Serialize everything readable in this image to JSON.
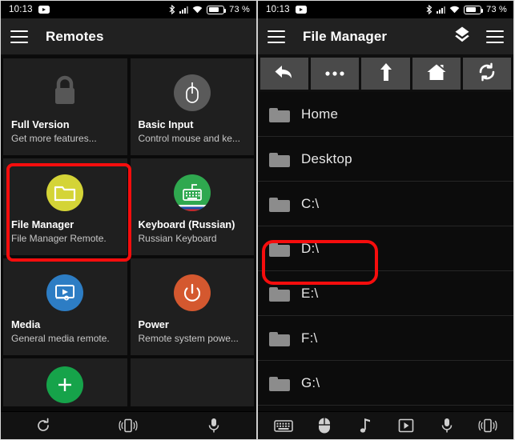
{
  "statusbar": {
    "time": "10:13",
    "notification_icon": "youtube-icon",
    "bluetooth_icon": "bluetooth-icon",
    "signal_icon": "cellular-signal-icon",
    "wifi_icon": "wifi-icon",
    "battery_icon": "battery-icon",
    "battery_percent": "73 %"
  },
  "left_phone": {
    "appbar": {
      "menu_icon": "hamburger-menu-icon",
      "title": "Remotes"
    },
    "tiles": [
      {
        "title": "Full Version",
        "subtitle": "Get more features...",
        "icon": "lock-icon",
        "icon_bg": "none",
        "icon_color": "#575757"
      },
      {
        "title": "Basic Input",
        "subtitle": "Control mouse and ke...",
        "icon": "mouse-icon",
        "icon_bg": "#5a5a5a",
        "icon_color": "#ffffff"
      },
      {
        "title": "File Manager",
        "subtitle": "File Manager Remote.",
        "icon": "folder-icon",
        "icon_bg": "#d4d437",
        "icon_color": "#ffffff",
        "highlighted": true
      },
      {
        "title": "Keyboard (Russian)",
        "subtitle": "Russian Keyboard",
        "icon": "keyboard-icon",
        "icon_bg": "#2fa84f",
        "icon_color": "#ffffff"
      },
      {
        "title": "Media",
        "subtitle": "General media remote.",
        "icon": "media-player-icon",
        "icon_bg": "#2d7dc4",
        "icon_color": "#ffffff"
      },
      {
        "title": "Power",
        "subtitle": "Remote system powe...",
        "icon": "power-icon",
        "icon_bg": "#d4582f",
        "icon_color": "#ffffff"
      },
      {
        "title": "",
        "subtitle": "",
        "icon": "add-icon",
        "icon_bg": "#16a34a",
        "icon_color": "#ffffff"
      },
      {
        "title": "",
        "subtitle": "",
        "icon": "",
        "icon_bg": "none",
        "icon_color": ""
      }
    ],
    "bottombar": [
      {
        "icon": "refresh-icon"
      },
      {
        "icon": "device-vibrate-icon"
      },
      {
        "icon": "microphone-icon"
      }
    ]
  },
  "right_phone": {
    "appbar": {
      "menu_icon": "hamburger-menu-icon",
      "title": "File Manager",
      "layers_icon": "layers-icon",
      "overflow_icon": "hamburger-menu-icon"
    },
    "toolbar": [
      {
        "icon": "back-arrow-icon"
      },
      {
        "icon": "more-dots-icon"
      },
      {
        "icon": "up-arrow-icon"
      },
      {
        "icon": "home-icon"
      },
      {
        "icon": "refresh-icon"
      }
    ],
    "files": [
      {
        "name": "Home",
        "icon": "folder-icon"
      },
      {
        "name": "Desktop",
        "icon": "folder-icon",
        "highlighted": true
      },
      {
        "name": "C:\\",
        "icon": "folder-icon"
      },
      {
        "name": "D:\\",
        "icon": "folder-icon"
      },
      {
        "name": "E:\\",
        "icon": "folder-icon"
      },
      {
        "name": "F:\\",
        "icon": "folder-icon"
      },
      {
        "name": "G:\\",
        "icon": "folder-icon"
      }
    ],
    "bottombar": [
      {
        "icon": "keyboard-icon"
      },
      {
        "icon": "mouse-icon"
      },
      {
        "icon": "music-note-icon"
      },
      {
        "icon": "media-player-icon"
      },
      {
        "icon": "microphone-icon"
      },
      {
        "icon": "device-vibrate-icon"
      }
    ]
  },
  "annotations": {
    "accent_color": "#f60d0d",
    "highlight_tile": "File Manager",
    "highlight_row": "Desktop"
  }
}
